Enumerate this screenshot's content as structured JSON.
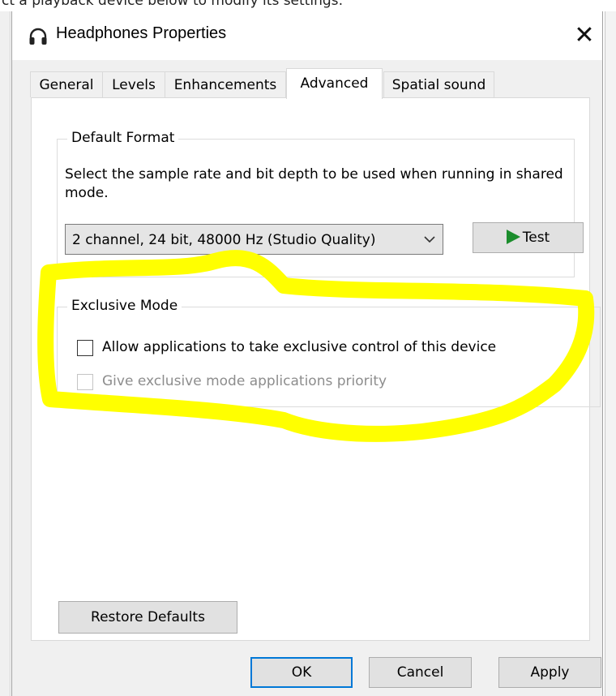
{
  "background": {
    "cut_text": "ct a playback device below to modify its settings:"
  },
  "dialog": {
    "title": "Headphones Properties",
    "title_icon": "headphones-icon",
    "close_glyph": "✕"
  },
  "tabs": [
    {
      "label": "General",
      "active": false
    },
    {
      "label": "Levels",
      "active": false
    },
    {
      "label": "Enhancements",
      "active": false
    },
    {
      "label": "Advanced",
      "active": true
    },
    {
      "label": "Spatial sound",
      "active": false
    }
  ],
  "default_format": {
    "title": "Default Format",
    "description": "Select the sample rate and bit depth to be used when running in shared mode.",
    "format_value": "2 channel, 24 bit, 48000 Hz (Studio Quality)",
    "test_label": "Test"
  },
  "exclusive_mode": {
    "title": "Exclusive Mode",
    "allow_label": "Allow applications to take exclusive control of this device",
    "allow_checked": false,
    "priority_label": "Give exclusive mode applications priority",
    "priority_checked": false,
    "priority_enabled": false
  },
  "buttons": {
    "restore_defaults": "Restore Defaults",
    "ok": "OK",
    "cancel": "Cancel",
    "apply": "Apply"
  },
  "colors": {
    "highlight": "#ffff00",
    "play_arrow": "#1b8d2c",
    "default_button_border": "#0078d7"
  }
}
